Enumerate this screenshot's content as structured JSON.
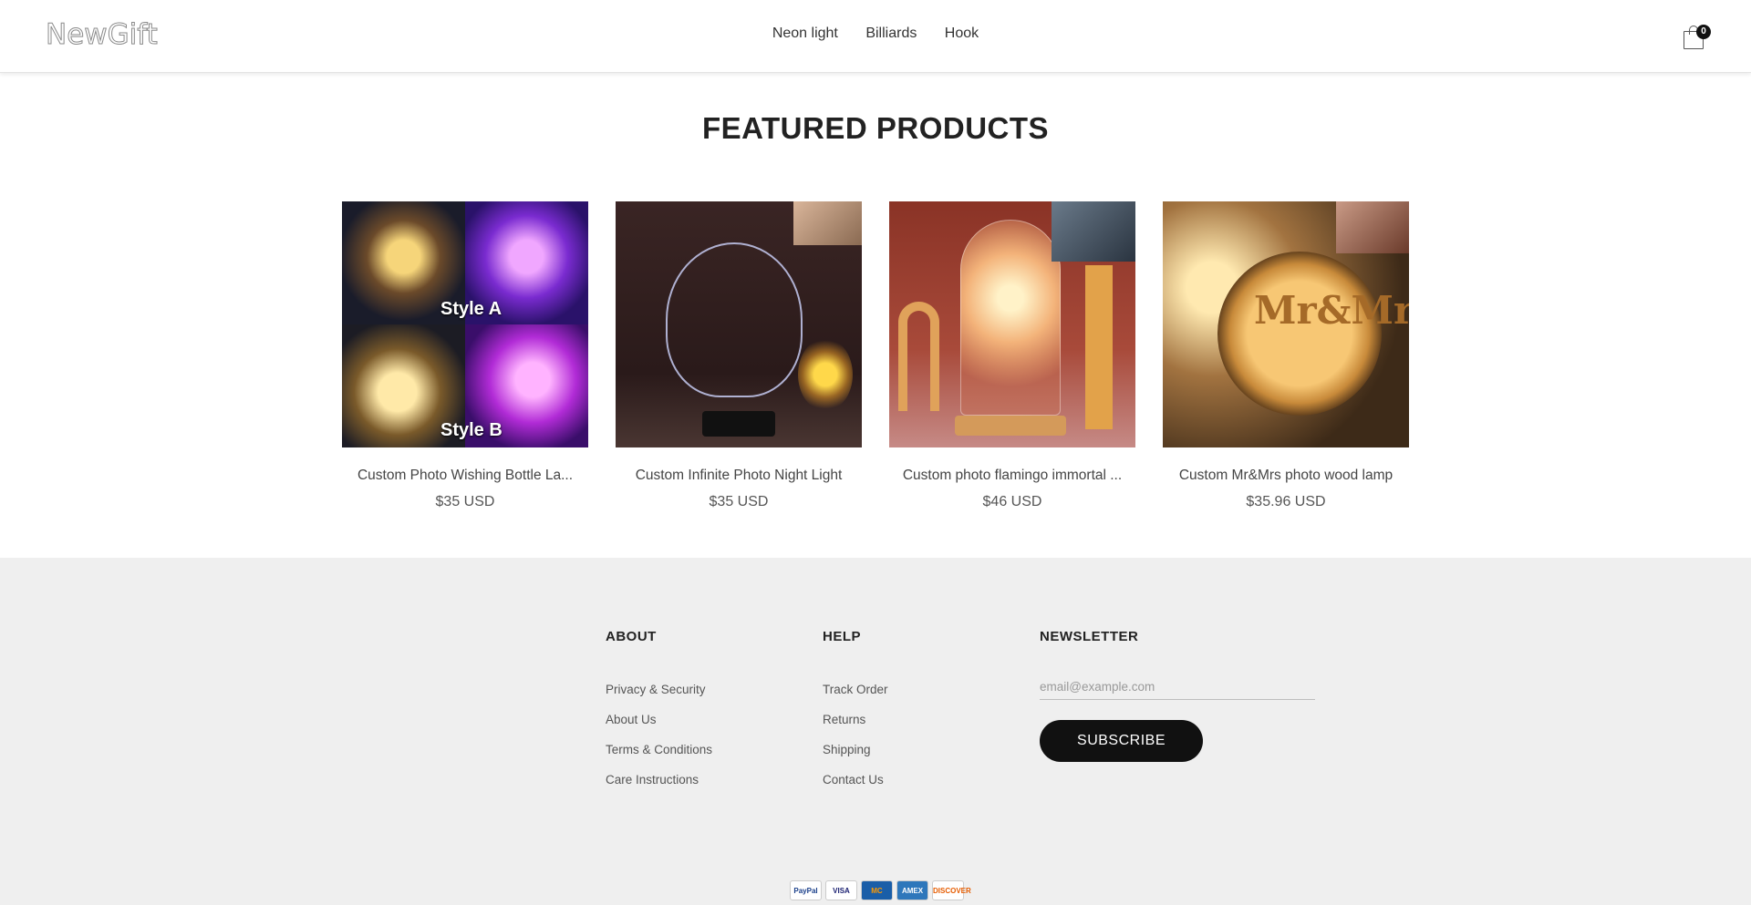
{
  "brand": {
    "logo": "NewGift"
  },
  "nav": {
    "items": [
      "Neon light",
      "Billiards",
      "Hook"
    ]
  },
  "cart": {
    "count": "0"
  },
  "featured": {
    "title": "FEATURED PRODUCTS",
    "products": [
      {
        "name": "Custom Photo Wishing Bottle La...",
        "price": "$35 USD",
        "image_text": [
          "Style A",
          "Style B"
        ]
      },
      {
        "name": "Custom Infinite Photo Night Light",
        "price": "$35 USD"
      },
      {
        "name": "Custom photo flamingo immortal ...",
        "price": "$46 USD"
      },
      {
        "name": "Custom Mr&Mrs photo wood lamp",
        "price": "$35.96 USD",
        "image_text": "Mr&Mrs"
      }
    ]
  },
  "footer": {
    "about": {
      "heading": "ABOUT",
      "links": [
        "Privacy & Security",
        "About Us",
        "Terms & Conditions",
        "Care Instructions"
      ]
    },
    "help": {
      "heading": "HELP",
      "links": [
        "Track Order",
        "Returns",
        "Shipping",
        "Contact Us"
      ]
    },
    "newsletter": {
      "heading": "NEWSLETTER",
      "placeholder": "email@example.com",
      "button": "SUBSCRIBE"
    },
    "payments": [
      {
        "label": "PayPal",
        "bg": "#ffffff",
        "fg": "#1a3f8a"
      },
      {
        "label": "VISA",
        "bg": "#ffffff",
        "fg": "#1a1f71"
      },
      {
        "label": "MC",
        "bg": "#1a5ea8",
        "fg": "#ff9a00"
      },
      {
        "label": "AMEX",
        "bg": "#2e77bb",
        "fg": "#ffffff"
      },
      {
        "label": "DISCOVER",
        "bg": "#ffffff",
        "fg": "#e65c00"
      }
    ]
  }
}
